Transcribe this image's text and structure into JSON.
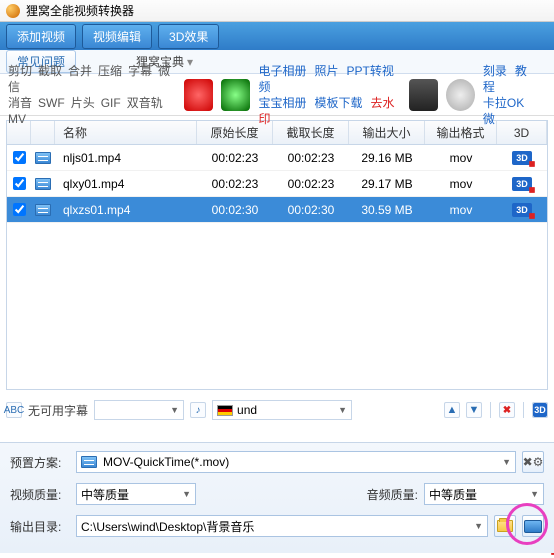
{
  "app": {
    "title": "狸窝全能视频转换器"
  },
  "toolbar": {
    "add": "添加视频",
    "edit": "视频编辑",
    "fx": "3D效果"
  },
  "faq": {
    "label": "常见问题",
    "link": "狸窝宝典"
  },
  "tags": {
    "row1": [
      "剪切",
      "截取",
      "合并",
      "压缩",
      "字幕",
      "微信"
    ],
    "row2": [
      "消音",
      "SWF",
      "片头",
      "GIF",
      "双音轨",
      "MV"
    ]
  },
  "banner": {
    "links1": [
      "电子相册",
      "照片",
      "PPT转视频"
    ],
    "links2": [
      "宝宝相册",
      "模板下载"
    ],
    "watermark": "去水印",
    "right1": [
      "刻录",
      "教程"
    ],
    "right2": [
      "卡拉OK",
      "微"
    ]
  },
  "columns": {
    "name": "名称",
    "orig": "原始长度",
    "clip": "截取长度",
    "size": "输出大小",
    "fmt": "输出格式",
    "threeD": "3D"
  },
  "rows": [
    {
      "checked": true,
      "name": "nljs01.mp4",
      "orig": "00:02:23",
      "clip": "00:02:23",
      "size": "29.16 MB",
      "fmt": "mov",
      "selected": false
    },
    {
      "checked": true,
      "name": "qlxy01.mp4",
      "orig": "00:02:23",
      "clip": "00:02:23",
      "size": "29.17 MB",
      "fmt": "mov",
      "selected": false
    },
    {
      "checked": true,
      "name": "qlxzs01.mp4",
      "orig": "00:02:30",
      "clip": "00:02:30",
      "size": "30.59 MB",
      "fmt": "mov",
      "selected": true
    }
  ],
  "subbar": {
    "subtitle_none": "无可用字幕",
    "audio_track": "und",
    "threeD_badge": "3D"
  },
  "preset": {
    "label": "预置方案:",
    "value": "MOV-QuickTime(*.mov)"
  },
  "vquality": {
    "label": "视频质量:",
    "value": "中等质量"
  },
  "aquality": {
    "label": "音频质量:",
    "value": "中等质量"
  },
  "output": {
    "label": "输出目录:",
    "value": "C:\\Users\\wind\\Desktop\\背景音乐"
  }
}
